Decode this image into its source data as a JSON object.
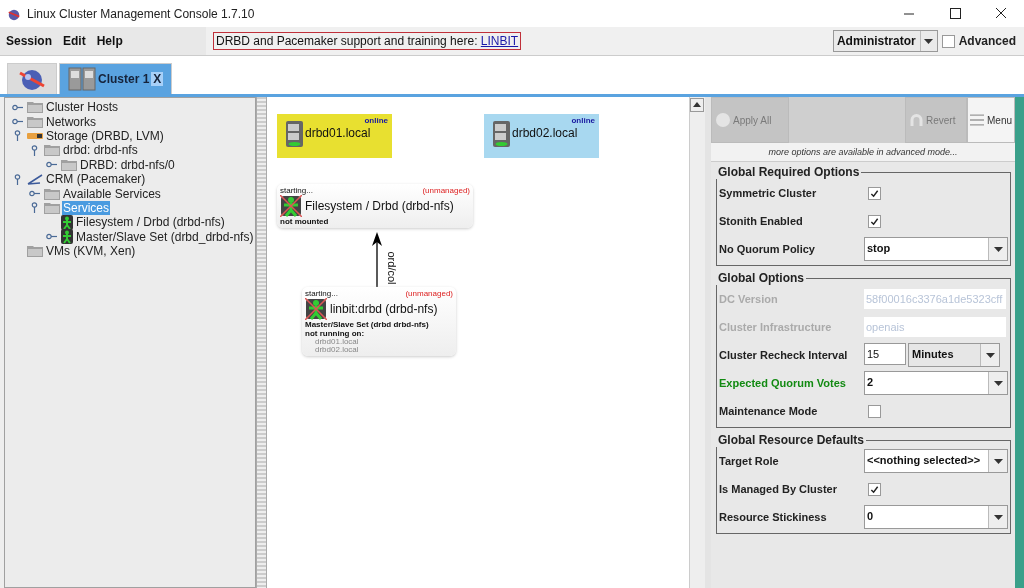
{
  "window": {
    "title": "Linux Cluster Management Console 1.7.10"
  },
  "menu": [
    "Session",
    "Edit",
    "Help"
  ],
  "banner": {
    "text": "DRBD and Pacemaker support and training here: ",
    "link": "LINBIT"
  },
  "user_select": {
    "value": "Administrator"
  },
  "advanced": {
    "label": "Advanced",
    "checked": false
  },
  "tabs": [
    {
      "kind": "home",
      "selected": false
    },
    {
      "kind": "cluster",
      "label": "Cluster 1",
      "close": "X",
      "selected": true
    }
  ],
  "tree": [
    {
      "label": "Cluster Hosts",
      "kind": "folder",
      "expanded": false,
      "selected": false
    },
    {
      "label": "Networks",
      "kind": "folder",
      "expanded": false,
      "selected": false
    },
    {
      "label": "Storage (DRBD, LVM)",
      "kind": "drbd",
      "expanded": true,
      "selected": false,
      "children": [
        {
          "label": "drbd: drbd-nfs",
          "kind": "folder",
          "expanded": true,
          "selected": false,
          "children": [
            {
              "label": "DRBD: drbd-nfs/0",
              "kind": "folder",
              "expanded": false,
              "selected": false
            }
          ]
        }
      ]
    },
    {
      "label": "CRM (Pacemaker)",
      "kind": "crm",
      "expanded": true,
      "selected": false,
      "children": [
        {
          "label": "Available Services",
          "kind": "folder",
          "expanded": false,
          "selected": false
        },
        {
          "label": "Services",
          "kind": "folder",
          "expanded": true,
          "selected": true,
          "children": [
            {
              "label": "Filesystem / Drbd (drbd-nfs)",
              "kind": "service",
              "selected": false
            },
            {
              "label": "Master/Slave Set (drbd_drbd-nfs)",
              "kind": "service",
              "expanded": false,
              "selected": false
            }
          ]
        }
      ]
    },
    {
      "label": "VMs (KVM, Xen)",
      "kind": "folder",
      "selected": false
    }
  ],
  "graph": {
    "hosts": [
      {
        "name": "drbd01.local",
        "status": "online",
        "color": "#e8e030"
      },
      {
        "name": "drbd02.local",
        "status": "online",
        "color": "#a8d8f0"
      }
    ],
    "services": [
      {
        "state": "starting...",
        "managed": "(unmanaged)",
        "name": "Filesystem / Drbd (drbd-nfs)",
        "lines": [
          {
            "text": "not mounted",
            "kind": "note"
          }
        ]
      },
      {
        "state": "starting...",
        "managed": "(unmanaged)",
        "name": "linbit:drbd (drbd-nfs)",
        "lines": [
          {
            "text": "Master/Slave Set (drbd drbd-nfs)",
            "kind": "note"
          },
          {
            "text": "not running on:",
            "kind": "note"
          },
          {
            "text": "drbd01.local",
            "kind": "host"
          },
          {
            "text": "drbd02.local",
            "kind": "host"
          }
        ]
      }
    ],
    "edge": {
      "label": "ord/col"
    }
  },
  "toolbar": [
    {
      "label": "Apply All",
      "kind": "apply",
      "disabled": true
    },
    {
      "label": "Revert",
      "kind": "revert",
      "disabled": true
    },
    {
      "label": "Menu",
      "kind": "menu",
      "disabled": false
    }
  ],
  "hint": "more options are available in advanced mode...",
  "groups": [
    {
      "title": "Global Required Options",
      "rows": [
        {
          "kind": "check",
          "label": "Symmetric Cluster",
          "checked": true,
          "disabled": false,
          "modified": false
        },
        {
          "kind": "check",
          "label": "Stonith Enabled",
          "checked": true,
          "disabled": false,
          "modified": false
        },
        {
          "kind": "select",
          "label": "No Quorum Policy",
          "value": "stop",
          "disabled": false,
          "modified": false
        }
      ]
    },
    {
      "title": "Global Options",
      "rows": [
        {
          "kind": "text",
          "label": "DC Version",
          "value": "58f00016c3376a1de5323cff",
          "disabled": true,
          "modified": false
        },
        {
          "kind": "text",
          "label": "Cluster Infrastructure",
          "value": "openais",
          "disabled": true,
          "modified": false
        },
        {
          "kind": "interval",
          "label": "Cluster Recheck Interval",
          "value": "15",
          "unit": "Minutes",
          "disabled": false,
          "modified": false
        },
        {
          "kind": "select",
          "label": "Expected Quorum Votes",
          "value": "2",
          "disabled": false,
          "modified": true
        },
        {
          "kind": "check",
          "label": "Maintenance Mode",
          "checked": false,
          "disabled": false,
          "modified": false
        }
      ]
    },
    {
      "title": "Global Resource Defaults",
      "rows": [
        {
          "kind": "select",
          "label": "Target Role",
          "value": "<<nothing selected>>",
          "disabled": false,
          "modified": false
        },
        {
          "kind": "check",
          "label": "Is Managed By Cluster",
          "checked": true,
          "disabled": false,
          "modified": false
        },
        {
          "kind": "select",
          "label": "Resource Stickiness",
          "value": "0",
          "disabled": false,
          "modified": false
        }
      ]
    }
  ]
}
